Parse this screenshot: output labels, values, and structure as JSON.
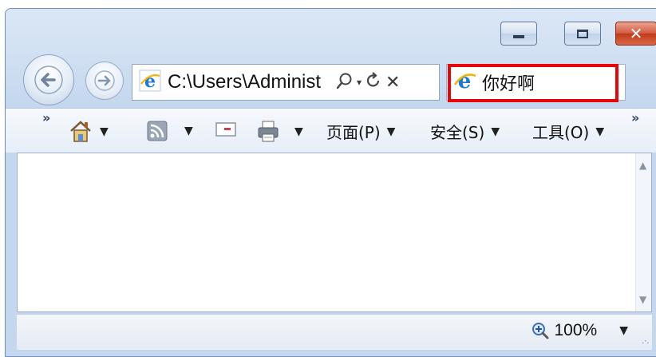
{
  "address_bar": {
    "url": "C:\\Users\\Administ",
    "search_icon": "search-icon",
    "dropdown_icon": "dropdown-arrow",
    "refresh_icon": "refresh-icon",
    "stop_icon": "stop-icon"
  },
  "tab": {
    "title": "你好啊",
    "highlight_color": "#e8050c"
  },
  "commandbar": {
    "page_label": "页面(P)",
    "safety_label": "安全(S)",
    "tools_label": "工具(O)"
  },
  "statusbar": {
    "zoom": "100%"
  },
  "colors": {
    "close_button": "#c8431f",
    "frame": "#cfdff2"
  }
}
